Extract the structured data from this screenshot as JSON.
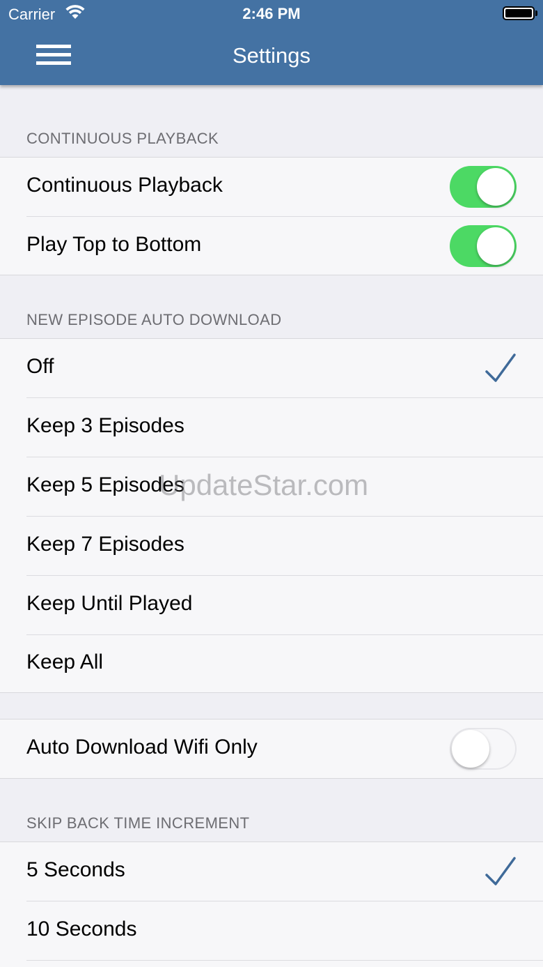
{
  "status_bar": {
    "carrier": "Carrier",
    "time": "2:46 PM"
  },
  "nav": {
    "title": "Settings",
    "menu_icon": "hamburger-menu-icon"
  },
  "sections": {
    "continuous_playback": {
      "header": "CONTINUOUS PLAYBACK",
      "rows": [
        {
          "label": "Continuous Playback",
          "toggle": true
        },
        {
          "label": "Play Top to Bottom",
          "toggle": true
        }
      ]
    },
    "auto_download": {
      "header": "NEW EPISODE AUTO DOWNLOAD",
      "options": [
        "Off",
        "Keep 3 Episodes",
        "Keep 5 Episodes",
        "Keep 7 Episodes",
        "Keep Until Played",
        "Keep All"
      ],
      "selected": "Off"
    },
    "wifi": {
      "label": "Auto Download Wifi Only",
      "toggle": false
    },
    "skip_back": {
      "header": "SKIP BACK TIME INCREMENT",
      "options": [
        "5 Seconds",
        "10 Seconds"
      ],
      "selected": "5 Seconds"
    }
  },
  "watermark": "UpdateStar.com",
  "colors": {
    "nav_bar": "#4472a3",
    "toggle_on": "#4cd964",
    "checkmark": "#3f6a99",
    "background": "#efeff4"
  }
}
